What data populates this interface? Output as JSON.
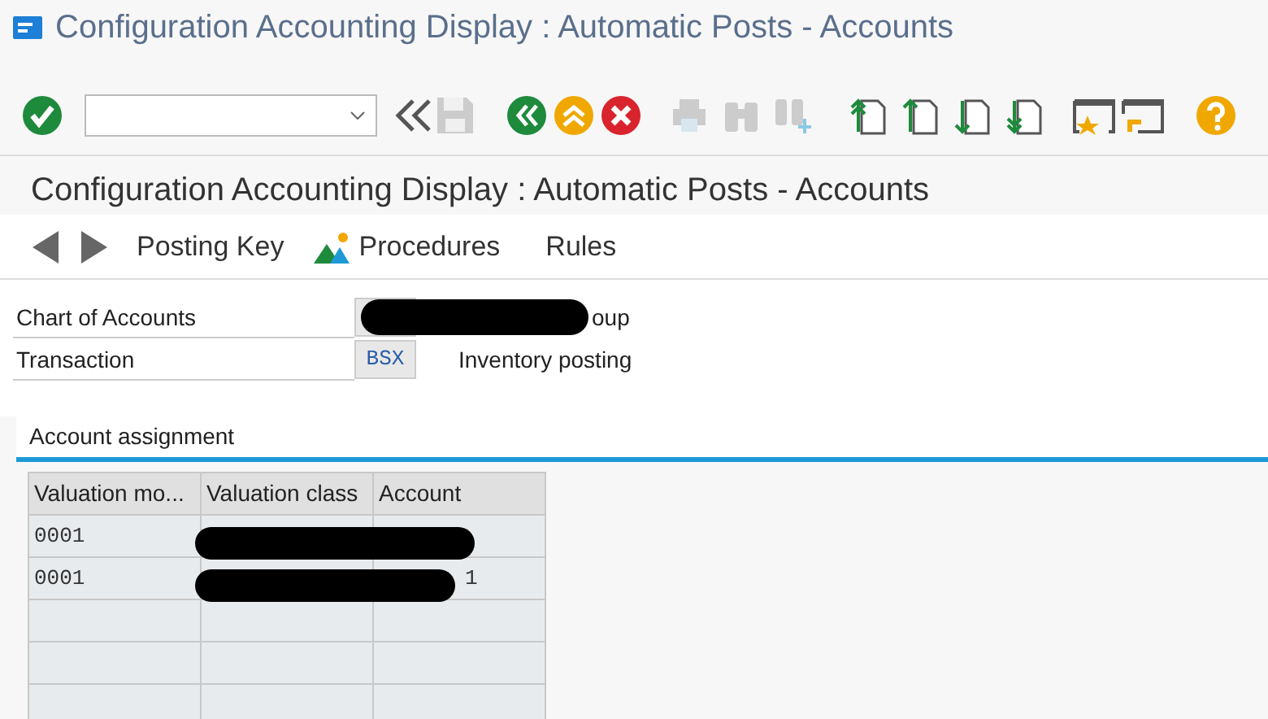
{
  "window": {
    "title": "Configuration Accounting Display : Automatic Posts - Accounts"
  },
  "page_title": "Configuration Accounting Display : Automatic Posts - Accounts",
  "nav": [
    {
      "kind": "back"
    },
    {
      "kind": "forward"
    },
    {
      "kind": "text",
      "label": "Posting Key"
    },
    {
      "kind": "procedures",
      "label": "Procedures"
    },
    {
      "kind": "text",
      "label": "Rules"
    }
  ],
  "fields": [
    {
      "label": "Chart of Accounts",
      "description": "oup",
      "redacted": true
    },
    {
      "label": "Transaction",
      "value": "BSX",
      "description": "Inventory posting",
      "redacted": false
    }
  ],
  "group": {
    "title": "Account assignment"
  },
  "table": {
    "columns": [
      "Valuation mo...",
      "Valuation class",
      "Account"
    ],
    "rows": [
      {
        "cells": [
          "0001",
          "",
          ""
        ],
        "redacted": true
      },
      {
        "cells": [
          "0001",
          "",
          "1"
        ],
        "redacted": true
      }
    ]
  }
}
